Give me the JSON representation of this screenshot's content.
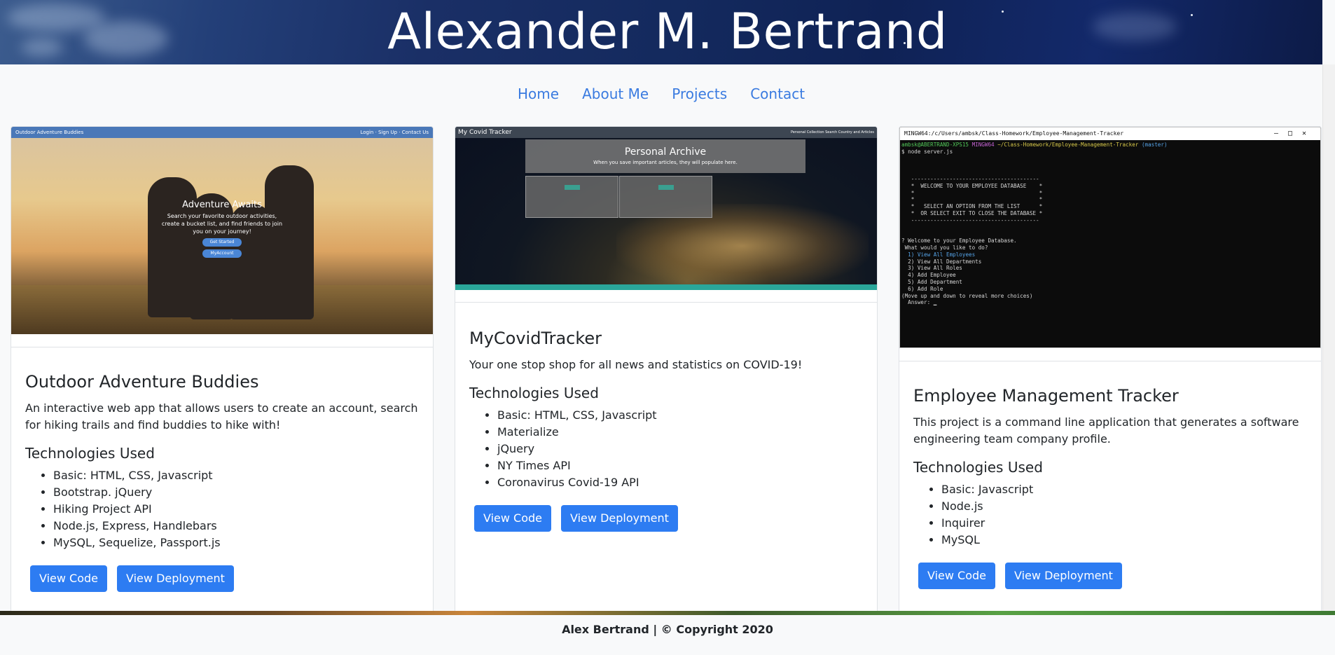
{
  "header": {
    "title": "Alexander M. Bertrand"
  },
  "nav": {
    "items": [
      "Home",
      "About Me",
      "Projects",
      "Contact"
    ]
  },
  "projects": [
    {
      "title": "Outdoor Adventure Buddies",
      "description": "An interactive web app that allows users to create an account, search for hiking trails and find buddies to hike with!",
      "tech_heading": "Technologies Used",
      "technologies": [
        "Basic: HTML, CSS, Javascript",
        "Bootstrap. jQuery",
        "Hiking Project API",
        "Node.js, Express, Handlebars",
        "MySQL, Sequelize, Passport.js"
      ],
      "code_label": "View Code",
      "deploy_label": "View Deployment",
      "thumbnail": {
        "brand": "Outdoor Adventure Buddies",
        "links": "Login · Sign Up · Contact Us",
        "hero_title": "Adventure Awaits",
        "hero_text": "Search your favorite outdoor activities, create a bucket list, and find friends to join you on your journey!",
        "btn1": "Get Started",
        "btn2": "MyAccount"
      }
    },
    {
      "title": "MyCovidTracker",
      "description": "Your one stop shop for all news and statistics on COVID-19!",
      "tech_heading": "Technologies Used",
      "technologies": [
        "Basic: HTML, CSS, Javascript",
        "Materialize",
        "jQuery",
        "NY Times API",
        "Coronavirus Covid-19 API"
      ],
      "code_label": "View Code",
      "deploy_label": "View Deployment",
      "thumbnail": {
        "brand": "My Covid Tracker",
        "links": "Personal Collection    Search Country and Articles",
        "panel_title": "Personal Archive",
        "panel_text": "When you save important articles, they will populate here."
      }
    },
    {
      "title": "Employee Management Tracker",
      "description": "This project is a command line application that generates a software engineering team company profile.",
      "tech_heading": "Technologies Used",
      "technologies": [
        "Basic: Javascript",
        "Node.js",
        "Inquirer",
        "MySQL"
      ],
      "code_label": "View Code",
      "deploy_label": "View Deployment",
      "thumbnail": {
        "window_title": "MINGW64:/c/Users/ambsk/Class-Homework/Employee-Management-Tracker"
      }
    }
  ],
  "footer": {
    "text": "Alex Bertrand | © Copyright 2020"
  },
  "colors": {
    "link": "#3a7be0",
    "button": "#2d7cf2"
  }
}
